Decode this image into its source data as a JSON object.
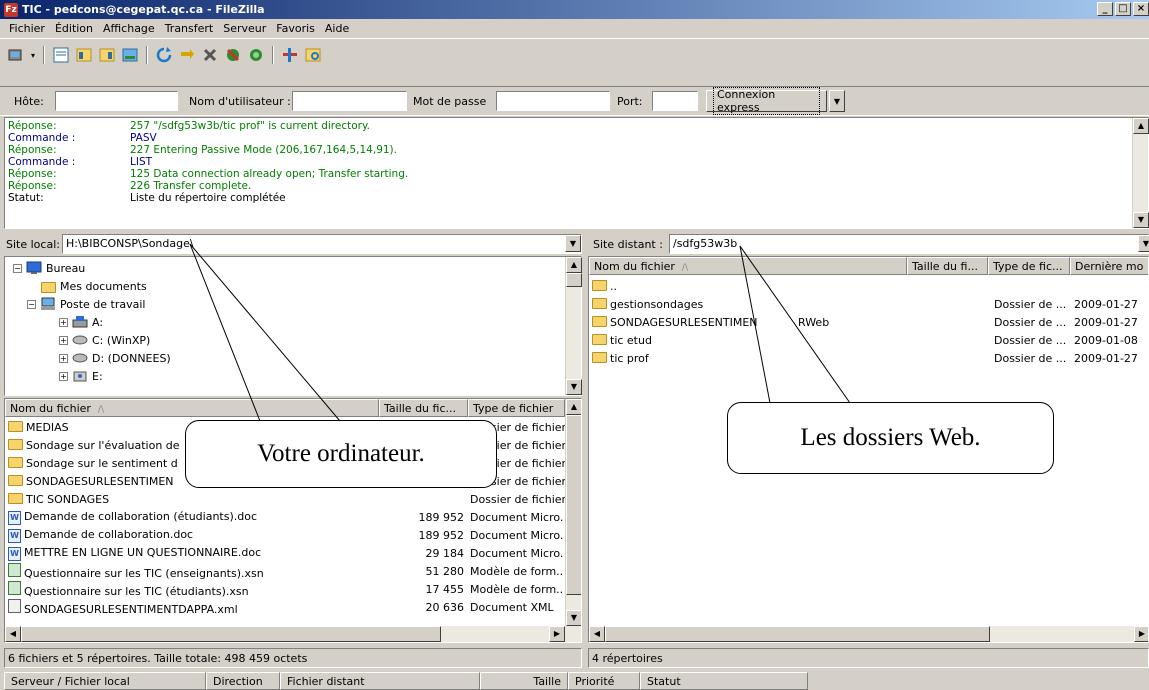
{
  "window": {
    "title": "TIC - pedcons@cegepat.qc.ca - FileZilla",
    "app_icon": "Fz",
    "controls": [
      "_",
      "□",
      "×"
    ]
  },
  "menu": [
    "Fichier",
    "Édition",
    "Affichage",
    "Transfert",
    "Serveur",
    "Favoris",
    "Aide"
  ],
  "toolbar_icons": [
    "site-manager-icon",
    "toggle-log-icon",
    "toggle-local-tree-icon",
    "toggle-remote-tree-icon",
    "toggle-queue-icon",
    "refresh-icon",
    "process-queue-icon",
    "cancel-icon",
    "disconnect-icon",
    "reconnect-icon",
    "filter-icon",
    "compare-icon"
  ],
  "quickconnect": {
    "host_label": "Hôte:",
    "user_label": "Nom d'utilisateur :",
    "pass_label": "Mot de passe",
    "port_label": "Port:",
    "button": "Connexion express",
    "dropdown_arrow": "▼"
  },
  "log": [
    {
      "type": "Réponse:",
      "msg": "257 \"/sdfg53w3b/tic prof\" is current directory.",
      "color": "green"
    },
    {
      "type": "Commande :",
      "msg": "PASV",
      "color": "blue"
    },
    {
      "type": "Réponse:",
      "msg": "227 Entering Passive Mode (206,167,164,5,14,91).",
      "color": "green"
    },
    {
      "type": "Commande :",
      "msg": "LIST",
      "color": "blue"
    },
    {
      "type": "Réponse:",
      "msg": "125 Data connection already open; Transfer starting.",
      "color": "green"
    },
    {
      "type": "Réponse:",
      "msg": "226 Transfer complete.",
      "color": "green"
    },
    {
      "type": "Statut:",
      "msg": "Liste du répertoire complétée",
      "color": "black"
    }
  ],
  "local": {
    "site_label": "Site local:",
    "path": "H:\\BIBCONSP\\Sondage\\",
    "tree": [
      {
        "label": "Bureau",
        "expander": "−"
      },
      {
        "label": "Mes documents",
        "expander": ""
      },
      {
        "label": "Poste de travail",
        "expander": "−"
      },
      {
        "label": "A:",
        "expander": "+"
      },
      {
        "label": "C: (WinXP)",
        "expander": "+"
      },
      {
        "label": "D: (DONNEES)",
        "expander": "+"
      },
      {
        "label": "E:",
        "expander": "+"
      }
    ],
    "columns": {
      "name": "Nom du fichier",
      "sort_indicator": "/\\",
      "size": "Taille du fic...",
      "type": "Type de fichier"
    },
    "files": [
      {
        "name": "MEDIAS",
        "size": "",
        "type": "Dossier de fichier",
        "icon": "folder"
      },
      {
        "name": "Sondage sur l'évaluation de",
        "size": "",
        "type": "Dossier de fichier",
        "icon": "folder"
      },
      {
        "name": "Sondage sur le sentiment d",
        "size": "",
        "type": "Dossier de fichier",
        "icon": "folder"
      },
      {
        "name": "SONDAGESURLESENTIMEN",
        "size": "",
        "type": "Dossier de fichier",
        "icon": "folder"
      },
      {
        "name": "TIC SONDAGES",
        "size": "",
        "type": "Dossier de fichier",
        "icon": "folder"
      },
      {
        "name": "Demande de collaboration (étudiants).doc",
        "size": "189 952",
        "type": "Document Micro.",
        "icon": "doc"
      },
      {
        "name": "Demande de collaboration.doc",
        "size": "189 952",
        "type": "Document Micro.",
        "icon": "doc"
      },
      {
        "name": "METTRE EN LIGNE UN QUESTIONNAIRE.doc",
        "size": "29 184",
        "type": "Document Micro.",
        "icon": "doc"
      },
      {
        "name": "Questionnaire sur les TIC (enseignants).xsn",
        "size": "51 280",
        "type": "Modèle de form..",
        "icon": "form"
      },
      {
        "name": "Questionnaire sur les TIC (étudiants).xsn",
        "size": "17 455",
        "type": "Modèle de form..",
        "icon": "form"
      },
      {
        "name": "SONDAGESURLESENTIMENTDAPPA.xml",
        "size": "20 636",
        "type": "Document XML",
        "icon": "xml"
      }
    ],
    "status": "6 fichiers et 5 répertoires. Taille totale: 498 459 octets"
  },
  "remote": {
    "site_label": "Site distant :",
    "path": "/sdfg53w3b",
    "columns": {
      "name": "Nom du fichier",
      "sort_indicator": "/\\",
      "size": "Taille du fi...",
      "type": "Type de fic...",
      "modified": "Dernière mo"
    },
    "files": [
      {
        "name": "..",
        "type": "",
        "modified": ""
      },
      {
        "name": "gestionsondages",
        "type": "Dossier de ...",
        "modified": "2009-01-27"
      },
      {
        "name": "SONDAGESURLESENTIMEN",
        "type": "Dossier de ...",
        "modified": "2009-01-27"
      },
      {
        "name": "tic etud",
        "type": "Dossier de ...",
        "modified": "2009-01-08"
      },
      {
        "name": "tic prof",
        "type": "Dossier de ...",
        "modified": "2009-01-27"
      }
    ],
    "fragment": "RWeb",
    "status": "4 répertoires"
  },
  "queue": {
    "columns": [
      "Serveur / Fichier local",
      "Direction",
      "Fichier distant",
      "Taille",
      "Priorité",
      "Statut"
    ]
  },
  "annotations": {
    "local": "Votre ordinateur.",
    "remote": "Les dossiers Web."
  }
}
